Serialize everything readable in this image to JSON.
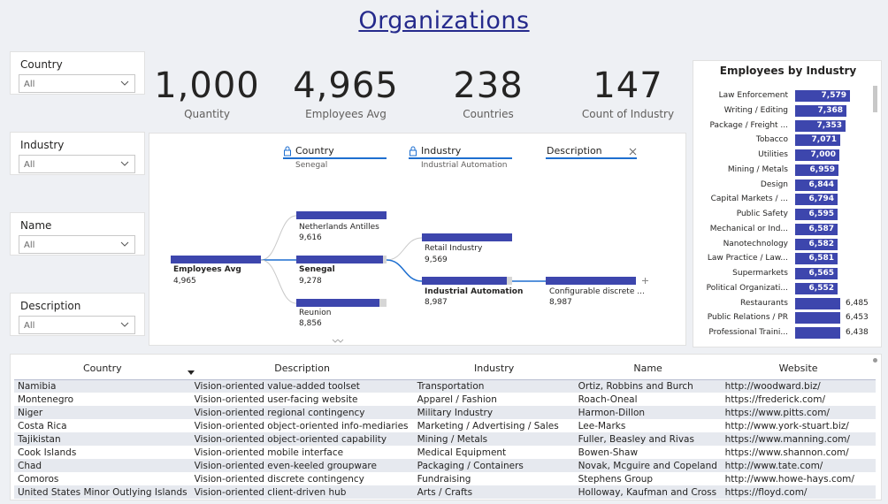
{
  "title": "Organizations",
  "slicers": [
    {
      "label": "Country",
      "value": "All"
    },
    {
      "label": "Industry",
      "value": "All"
    },
    {
      "label": "Name",
      "value": "All"
    },
    {
      "label": "Description",
      "value": "All"
    }
  ],
  "kpis": [
    {
      "value": "1,000",
      "label": "Quantity"
    },
    {
      "value": "4,965",
      "label": "Employees Avg"
    },
    {
      "value": "238",
      "label": "Countries"
    },
    {
      "value": "147",
      "label": "Count of Industry"
    }
  ],
  "tree": {
    "headers": [
      {
        "label": "Country",
        "sub": "Senegal"
      },
      {
        "label": "Industry",
        "sub": "Industrial Automation"
      },
      {
        "label": "Description",
        "sub": ""
      }
    ],
    "root": {
      "label": "Employees Avg",
      "value": "4,965",
      "fill": 1.0
    },
    "level1": [
      {
        "label": "Netherlands Antilles",
        "value": "9,616",
        "fill": 1.0
      },
      {
        "label": "Senegal",
        "value": "9,278",
        "fill": 0.965
      },
      {
        "label": "Reunion",
        "value": "8,856",
        "fill": 0.921
      }
    ],
    "level2": [
      {
        "label": "Retail Industry",
        "value": "9,569",
        "fill": 1.0
      },
      {
        "label": "Industrial Automation",
        "value": "8,987",
        "fill": 0.939
      }
    ],
    "level3": [
      {
        "label": "Configurable discrete ...",
        "value": "8,987",
        "fill": 1.0
      }
    ]
  },
  "chart_data": {
    "type": "bar",
    "title": "Employees by Industry",
    "orientation": "horizontal",
    "categories": [
      "Law Enforcement",
      "Writing / Editing",
      "Package / Freight ...",
      "Tobacco",
      "Utilities",
      "Mining / Metals",
      "Design",
      "Capital Markets / ...",
      "Public Safety",
      "Mechanical or Ind...",
      "Nanotechnology",
      "Law Practice / Law...",
      "Supermarkets",
      "Political Organizati...",
      "Restaurants",
      "Public Relations / PR",
      "Professional Traini..."
    ],
    "values": [
      7579,
      7368,
      7353,
      7071,
      7000,
      6959,
      6844,
      6794,
      6595,
      6587,
      6582,
      6581,
      6565,
      6552,
      6485,
      6453,
      6438
    ],
    "labels": [
      "7,579",
      "7,368",
      "7,353",
      "7,071",
      "7,000",
      "6,959",
      "6,844",
      "6,794",
      "6,595",
      "6,587",
      "6,582",
      "6,581",
      "6,565",
      "6,552",
      "6,485",
      "6,453",
      "6,438"
    ],
    "color": "#3d46ad"
  },
  "table": {
    "columns": [
      "Country",
      "Description",
      "Industry",
      "Name",
      "Website"
    ],
    "rows": [
      [
        "Namibia",
        "Vision-oriented value-added toolset",
        "Transportation",
        "Ortiz, Robbins and Burch",
        "http://woodward.biz/"
      ],
      [
        "Montenegro",
        "Vision-oriented user-facing website",
        "Apparel / Fashion",
        "Roach-Oneal",
        "https://frederick.com/"
      ],
      [
        "Niger",
        "Vision-oriented regional contingency",
        "Military Industry",
        "Harmon-Dillon",
        "https://www.pitts.com/"
      ],
      [
        "Costa Rica",
        "Vision-oriented object-oriented info-mediaries",
        "Marketing / Advertising / Sales",
        "Lee-Marks",
        "http://www.york-stuart.biz/"
      ],
      [
        "Tajikistan",
        "Vision-oriented object-oriented capability",
        "Mining / Metals",
        "Fuller, Beasley and Rivas",
        "https://www.manning.com/"
      ],
      [
        "Cook Islands",
        "Vision-oriented mobile interface",
        "Medical Equipment",
        "Bowen-Shaw",
        "https://www.shannon.com/"
      ],
      [
        "Chad",
        "Vision-oriented even-keeled groupware",
        "Packaging / Containers",
        "Novak, Mcguire and Copeland",
        "http://www.tate.com/"
      ],
      [
        "Comoros",
        "Vision-oriented discrete contingency",
        "Fundraising",
        "Stephens Group",
        "http://www.howe-hays.com/"
      ],
      [
        "United States Minor Outlying Islands",
        "Vision-oriented client-driven hub",
        "Arts / Crafts",
        "Holloway, Kaufman and Cross",
        "https://floyd.com/"
      ]
    ]
  }
}
